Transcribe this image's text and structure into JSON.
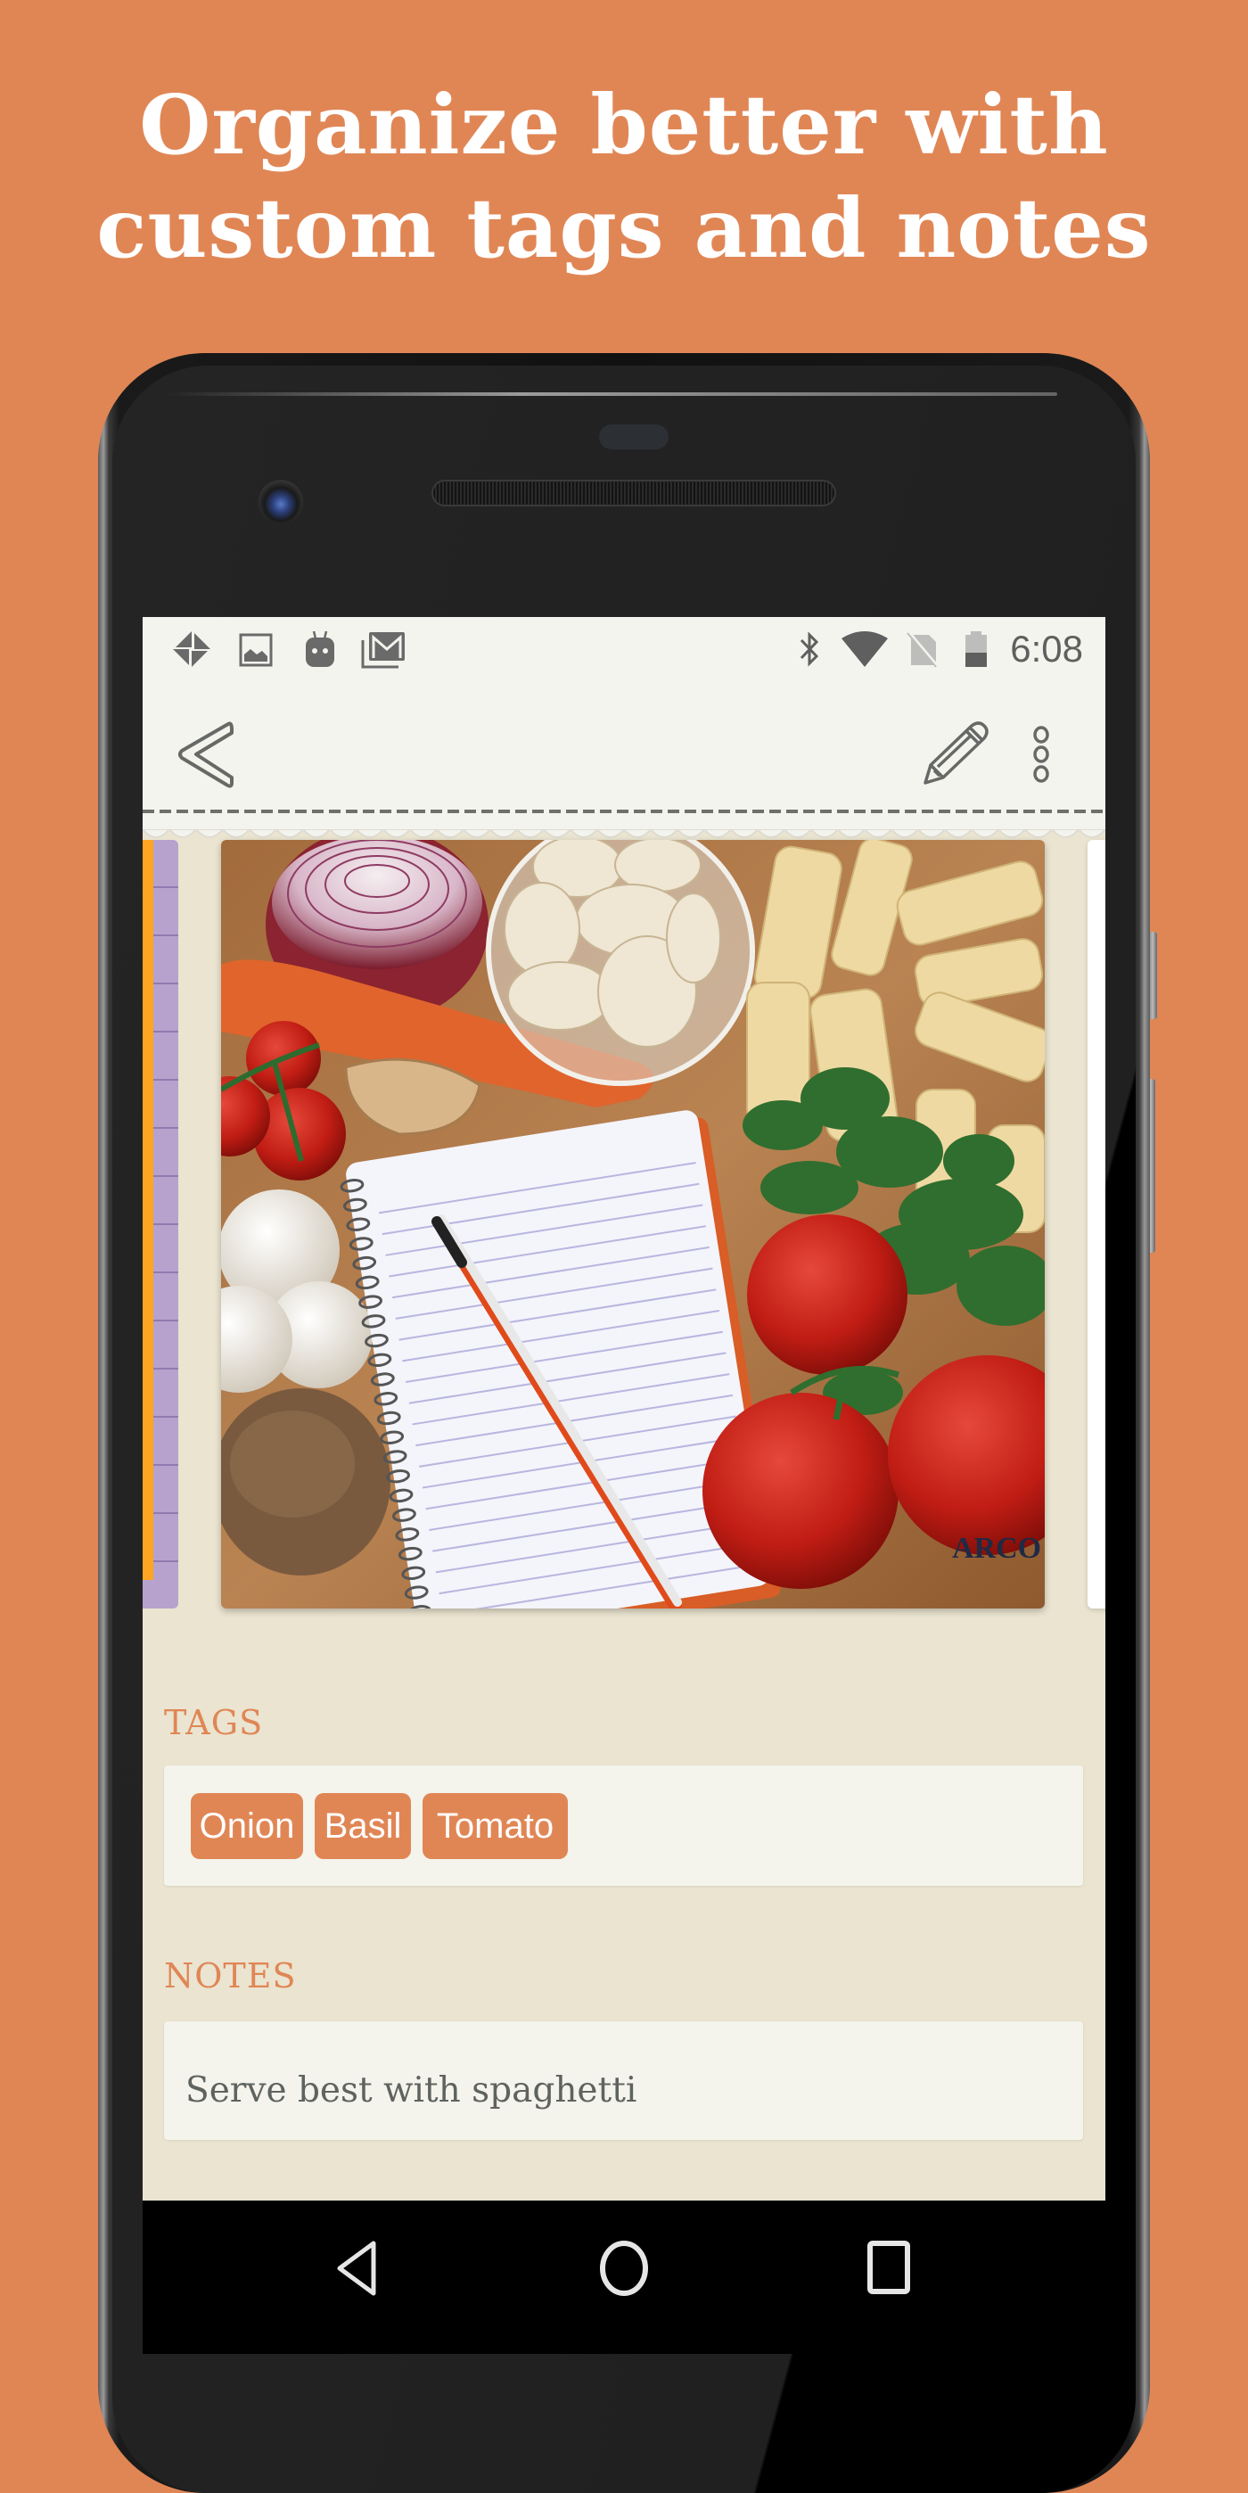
{
  "headline": {
    "line1": "Organize better with",
    "line2": "custom tags and notes"
  },
  "colors": {
    "background": "#E08655",
    "accent": "#E08655",
    "screen_bg": "#EAE4D0",
    "bar_bg": "#F4F4EE",
    "icon_gray": "#5f5f5f"
  },
  "status_bar": {
    "notification_icons": [
      "pinwheel-icon",
      "image-icon",
      "android-icon",
      "gmail-icon"
    ],
    "system_icons": [
      "bluetooth-icon",
      "wifi-icon",
      "no-sim-icon",
      "battery-icon"
    ],
    "time": "6:08"
  },
  "toolbar": {
    "back_icon": "chevron-left-icon",
    "edit_icon": "pencil-icon",
    "more_icon": "overflow-menu-icon"
  },
  "carousel": {
    "current_image": "Recipe ingredients: onion, garlic, rigatoni, carrot, tomatoes, mushrooms, parsley and a spiral notepad with pen"
  },
  "tags": {
    "label": "TAGS",
    "items": [
      "Onion",
      "Basil",
      "Tomato"
    ]
  },
  "notes": {
    "label": "NOTES",
    "text": "Serve best with spaghetti"
  },
  "nav_bar": {
    "back": "back-triangle-icon",
    "home": "home-circle-icon",
    "recents": "recents-square-icon"
  }
}
